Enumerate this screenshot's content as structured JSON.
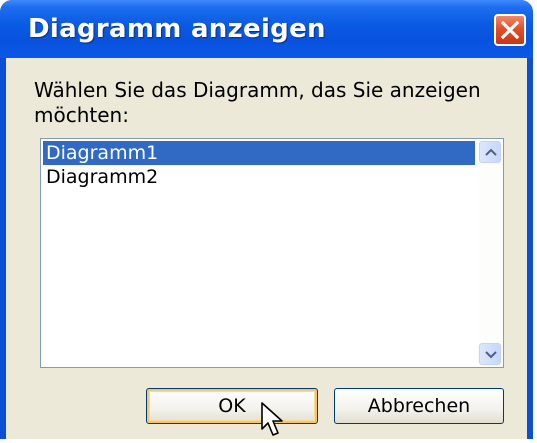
{
  "window": {
    "title": "Diagramm anzeigen"
  },
  "dialog": {
    "prompt": "Wählen Sie das Diagramm, das Sie anzeigen möchten:",
    "list": {
      "items": [
        {
          "label": "Diagramm1",
          "selected": true
        },
        {
          "label": "Diagramm2",
          "selected": false
        }
      ]
    },
    "buttons": {
      "ok_label": "OK",
      "cancel_label": "Abbrechen"
    }
  },
  "icons": {
    "close": "close-icon",
    "scroll_up": "chevron-up-icon",
    "scroll_down": "chevron-down-icon",
    "cursor": "mouse-pointer-icon"
  },
  "colors": {
    "titlebar": "#0a5ce4",
    "close_button": "#e2502a",
    "client_background": "#ece9d8",
    "selection": "#316ac5",
    "default_button_focus": "#f6c56b"
  }
}
